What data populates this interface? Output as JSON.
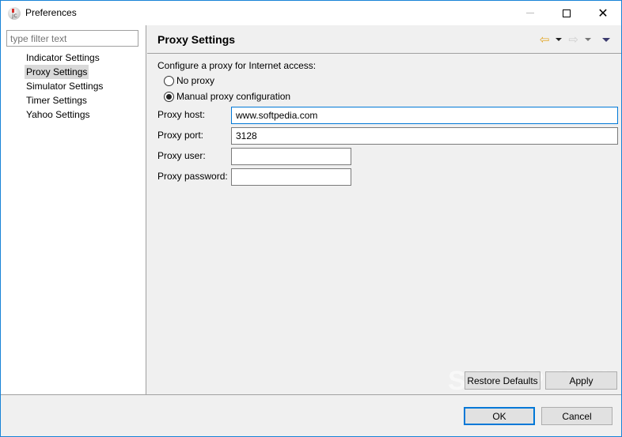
{
  "window": {
    "title": "Preferences",
    "app_icon": "java-app-icon",
    "controls": {
      "minimize": "minimize-icon",
      "maximize": "maximize-icon",
      "close": "close-icon"
    },
    "close_glyph": "✕",
    "border_color": "#1883d7"
  },
  "sidebar": {
    "filter_placeholder": "type filter text",
    "items": [
      {
        "label": "Indicator Settings",
        "selected": false
      },
      {
        "label": "Proxy Settings",
        "selected": true
      },
      {
        "label": "Simulator Settings",
        "selected": false
      },
      {
        "label": "Timer Settings",
        "selected": false
      },
      {
        "label": "Yahoo Settings",
        "selected": false
      }
    ]
  },
  "page": {
    "title": "Proxy Settings",
    "nav": {
      "back_glyph": "⇦",
      "forward_glyph": "⇨"
    },
    "description": "Configure a proxy for Internet access:",
    "radios": [
      {
        "label": "No proxy",
        "checked": false
      },
      {
        "label": "Manual proxy configuration",
        "checked": true
      }
    ],
    "fields": [
      {
        "label": "Proxy host:",
        "value": "www.softpedia.com"
      },
      {
        "label": "Proxy port:",
        "value": "3128"
      },
      {
        "label": "Proxy user:",
        "value": ""
      },
      {
        "label": "Proxy password:",
        "value": ""
      }
    ],
    "restore_defaults_label": "Restore Defaults",
    "apply_label": "Apply"
  },
  "footer": {
    "ok_label": "OK",
    "cancel_label": "Cancel"
  },
  "watermark": "SOFTPEDIA",
  "colors": {
    "accent": "#0078d7",
    "selection": "#d9d9d9",
    "back_arrow": "#e3a82a"
  }
}
